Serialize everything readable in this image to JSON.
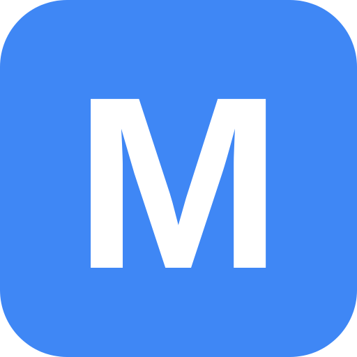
{
  "app_icon": {
    "letter": "M",
    "background_color": "#3f87f5",
    "foreground_color": "#ffffff"
  }
}
